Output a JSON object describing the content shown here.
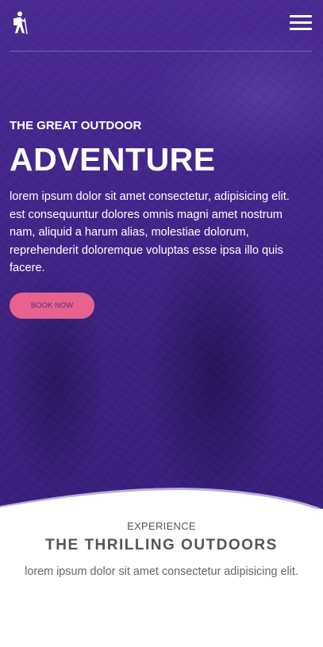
{
  "nav": {
    "logo_icon": "hiker-icon",
    "menu_icon": "hamburger-menu-icon"
  },
  "hero": {
    "eyebrow": "THE GREAT OUTDOOR",
    "title": "ADVENTURE",
    "description": "lorem ipsum dolor sit amet consectetur, adipisicing elit. est consequuntur dolores omnis magni amet nostrum nam, aliquid a harum alias, molestiae dolorum, reprehenderit doloremque voluptas esse ipsa illo quis facere.",
    "cta_label": "BOOK NOW"
  },
  "experience": {
    "eyebrow": "EXPERIENCE",
    "title": "THE THRILLING OUTDOORS",
    "text": "lorem ipsum dolor sit amet consectetur adipisicing elit."
  },
  "colors": {
    "hero_overlay": "#44258a",
    "accent": "#e8628f",
    "heading_text": "#555555"
  }
}
